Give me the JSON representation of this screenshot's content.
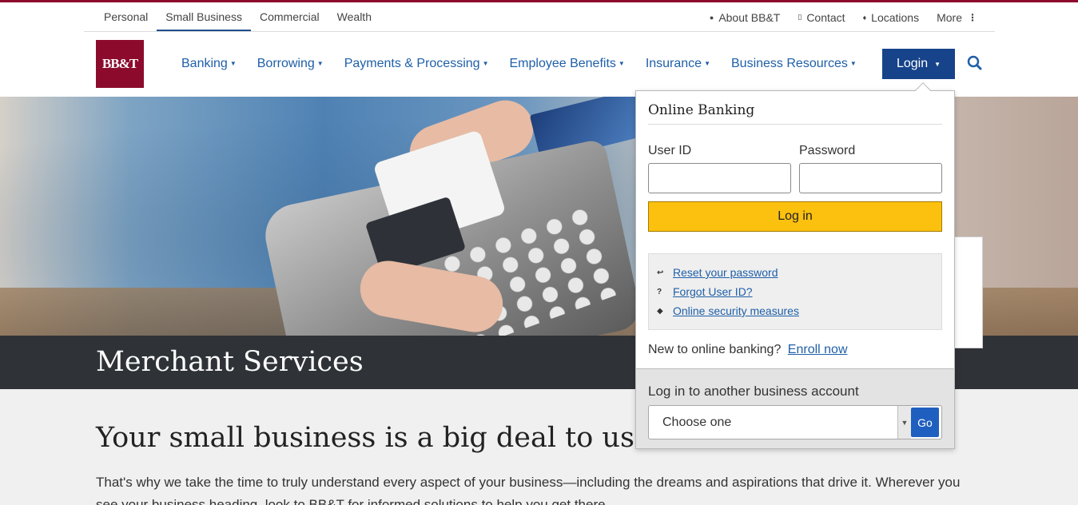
{
  "segments": [
    "Personal",
    "Small Business",
    "Commercial",
    "Wealth"
  ],
  "active_segment": "Small Business",
  "utility_links": [
    {
      "label": "About BB&T",
      "icon": "person-icon"
    },
    {
      "label": "Contact",
      "icon": "phone-icon"
    },
    {
      "label": "Locations",
      "icon": "location-pin-icon"
    }
  ],
  "more_label": "More",
  "logo_text": "BB&T",
  "nav": [
    "Banking",
    "Borrowing",
    "Payments & Processing",
    "Employee Benefits",
    "Insurance",
    "Business Resources"
  ],
  "login_button": "Login",
  "hero_title": "Merchant Services",
  "headline": "Your small business is a big deal to us",
  "paragraph": "That's why we take the time to truly understand every aspect of your business—including the dreams and aspirations that drive it. Wherever you see your business heading, look to BB&T for informed solutions to help you get there.",
  "login_panel": {
    "title": "Online Banking",
    "user_id_label": "User ID",
    "password_label": "Password",
    "submit_label": "Log in",
    "help_links": [
      {
        "label": "Reset your password",
        "icon": "key-icon",
        "glyph": "↩"
      },
      {
        "label": "Forgot User ID?",
        "icon": "question-icon",
        "glyph": "?"
      },
      {
        "label": "Online security measures",
        "icon": "shield-icon",
        "glyph": "◆"
      }
    ],
    "new_text": "New to online banking?",
    "enroll_label": "Enroll now",
    "another_label": "Log in to another business account",
    "select_value": "Choose one",
    "go_label": "Go"
  },
  "colors": {
    "brand": "#8c0b2d",
    "nav_blue": "#1f5fa8",
    "login_blue": "#16438a",
    "login_yellow": "#fcc10f"
  }
}
